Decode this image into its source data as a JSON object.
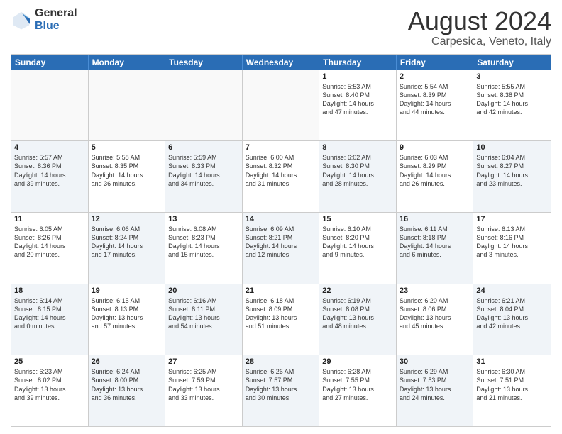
{
  "logo": {
    "general": "General",
    "blue": "Blue"
  },
  "title": "August 2024",
  "location": "Carpesica, Veneto, Italy",
  "days": [
    "Sunday",
    "Monday",
    "Tuesday",
    "Wednesday",
    "Thursday",
    "Friday",
    "Saturday"
  ],
  "rows": [
    [
      {
        "day": "",
        "info": "",
        "empty": true
      },
      {
        "day": "",
        "info": "",
        "empty": true
      },
      {
        "day": "",
        "info": "",
        "empty": true
      },
      {
        "day": "",
        "info": "",
        "empty": true
      },
      {
        "day": "1",
        "info": "Sunrise: 5:53 AM\nSunset: 8:40 PM\nDaylight: 14 hours\nand 47 minutes."
      },
      {
        "day": "2",
        "info": "Sunrise: 5:54 AM\nSunset: 8:39 PM\nDaylight: 14 hours\nand 44 minutes."
      },
      {
        "day": "3",
        "info": "Sunrise: 5:55 AM\nSunset: 8:38 PM\nDaylight: 14 hours\nand 42 minutes."
      }
    ],
    [
      {
        "day": "4",
        "info": "Sunrise: 5:57 AM\nSunset: 8:36 PM\nDaylight: 14 hours\nand 39 minutes.",
        "shaded": true
      },
      {
        "day": "5",
        "info": "Sunrise: 5:58 AM\nSunset: 8:35 PM\nDaylight: 14 hours\nand 36 minutes."
      },
      {
        "day": "6",
        "info": "Sunrise: 5:59 AM\nSunset: 8:33 PM\nDaylight: 14 hours\nand 34 minutes.",
        "shaded": true
      },
      {
        "day": "7",
        "info": "Sunrise: 6:00 AM\nSunset: 8:32 PM\nDaylight: 14 hours\nand 31 minutes."
      },
      {
        "day": "8",
        "info": "Sunrise: 6:02 AM\nSunset: 8:30 PM\nDaylight: 14 hours\nand 28 minutes.",
        "shaded": true
      },
      {
        "day": "9",
        "info": "Sunrise: 6:03 AM\nSunset: 8:29 PM\nDaylight: 14 hours\nand 26 minutes."
      },
      {
        "day": "10",
        "info": "Sunrise: 6:04 AM\nSunset: 8:27 PM\nDaylight: 14 hours\nand 23 minutes.",
        "shaded": true
      }
    ],
    [
      {
        "day": "11",
        "info": "Sunrise: 6:05 AM\nSunset: 8:26 PM\nDaylight: 14 hours\nand 20 minutes."
      },
      {
        "day": "12",
        "info": "Sunrise: 6:06 AM\nSunset: 8:24 PM\nDaylight: 14 hours\nand 17 minutes.",
        "shaded": true
      },
      {
        "day": "13",
        "info": "Sunrise: 6:08 AM\nSunset: 8:23 PM\nDaylight: 14 hours\nand 15 minutes."
      },
      {
        "day": "14",
        "info": "Sunrise: 6:09 AM\nSunset: 8:21 PM\nDaylight: 14 hours\nand 12 minutes.",
        "shaded": true
      },
      {
        "day": "15",
        "info": "Sunrise: 6:10 AM\nSunset: 8:20 PM\nDaylight: 14 hours\nand 9 minutes."
      },
      {
        "day": "16",
        "info": "Sunrise: 6:11 AM\nSunset: 8:18 PM\nDaylight: 14 hours\nand 6 minutes.",
        "shaded": true
      },
      {
        "day": "17",
        "info": "Sunrise: 6:13 AM\nSunset: 8:16 PM\nDaylight: 14 hours\nand 3 minutes."
      }
    ],
    [
      {
        "day": "18",
        "info": "Sunrise: 6:14 AM\nSunset: 8:15 PM\nDaylight: 14 hours\nand 0 minutes.",
        "shaded": true
      },
      {
        "day": "19",
        "info": "Sunrise: 6:15 AM\nSunset: 8:13 PM\nDaylight: 13 hours\nand 57 minutes."
      },
      {
        "day": "20",
        "info": "Sunrise: 6:16 AM\nSunset: 8:11 PM\nDaylight: 13 hours\nand 54 minutes.",
        "shaded": true
      },
      {
        "day": "21",
        "info": "Sunrise: 6:18 AM\nSunset: 8:09 PM\nDaylight: 13 hours\nand 51 minutes."
      },
      {
        "day": "22",
        "info": "Sunrise: 6:19 AM\nSunset: 8:08 PM\nDaylight: 13 hours\nand 48 minutes.",
        "shaded": true
      },
      {
        "day": "23",
        "info": "Sunrise: 6:20 AM\nSunset: 8:06 PM\nDaylight: 13 hours\nand 45 minutes."
      },
      {
        "day": "24",
        "info": "Sunrise: 6:21 AM\nSunset: 8:04 PM\nDaylight: 13 hours\nand 42 minutes.",
        "shaded": true
      }
    ],
    [
      {
        "day": "25",
        "info": "Sunrise: 6:23 AM\nSunset: 8:02 PM\nDaylight: 13 hours\nand 39 minutes."
      },
      {
        "day": "26",
        "info": "Sunrise: 6:24 AM\nSunset: 8:00 PM\nDaylight: 13 hours\nand 36 minutes.",
        "shaded": true
      },
      {
        "day": "27",
        "info": "Sunrise: 6:25 AM\nSunset: 7:59 PM\nDaylight: 13 hours\nand 33 minutes."
      },
      {
        "day": "28",
        "info": "Sunrise: 6:26 AM\nSunset: 7:57 PM\nDaylight: 13 hours\nand 30 minutes.",
        "shaded": true
      },
      {
        "day": "29",
        "info": "Sunrise: 6:28 AM\nSunset: 7:55 PM\nDaylight: 13 hours\nand 27 minutes."
      },
      {
        "day": "30",
        "info": "Sunrise: 6:29 AM\nSunset: 7:53 PM\nDaylight: 13 hours\nand 24 minutes.",
        "shaded": true
      },
      {
        "day": "31",
        "info": "Sunrise: 6:30 AM\nSunset: 7:51 PM\nDaylight: 13 hours\nand 21 minutes."
      }
    ]
  ]
}
